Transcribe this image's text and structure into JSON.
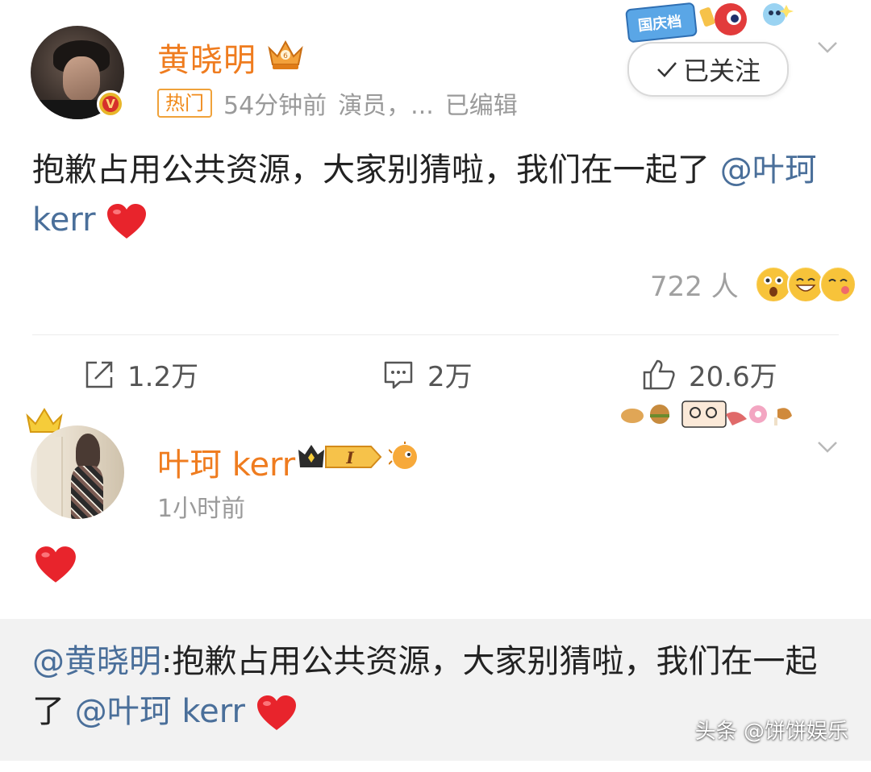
{
  "post": {
    "author": "黄晓明",
    "hot_badge": "热门",
    "time": "54分钟前",
    "category": "演员，...",
    "edited": "已编辑",
    "follow_label": "已关注",
    "text_main": "抱歉占用公共资源，大家别猜啦，我们在一起了",
    "mention": "@叶珂 kerr",
    "reactions_count": "722 人",
    "actions": {
      "share": "1.2万",
      "comment": "2万",
      "like": "20.6万"
    },
    "promo_label": "国庆档"
  },
  "comment": {
    "author": "叶珂 kerr",
    "time": "1小时前",
    "level_label": "I"
  },
  "repost": {
    "mention_author": "@黄晓明",
    "text": ":抱歉占用公共资源，大家别猜啦，我们在一起了 ",
    "mention": "@叶珂 kerr"
  },
  "watermark": "头条 @饼饼娱乐",
  "colors": {
    "name": "#ef7c1f",
    "mention": "#4a6f9a",
    "meta": "#9a9a9a",
    "repost_bg": "#f2f2f2",
    "heart": "#e8242c"
  },
  "icons": {
    "share": "share-icon",
    "comment": "comment-icon",
    "like": "thumbs-up-icon",
    "menu": "chevron-down-icon"
  }
}
